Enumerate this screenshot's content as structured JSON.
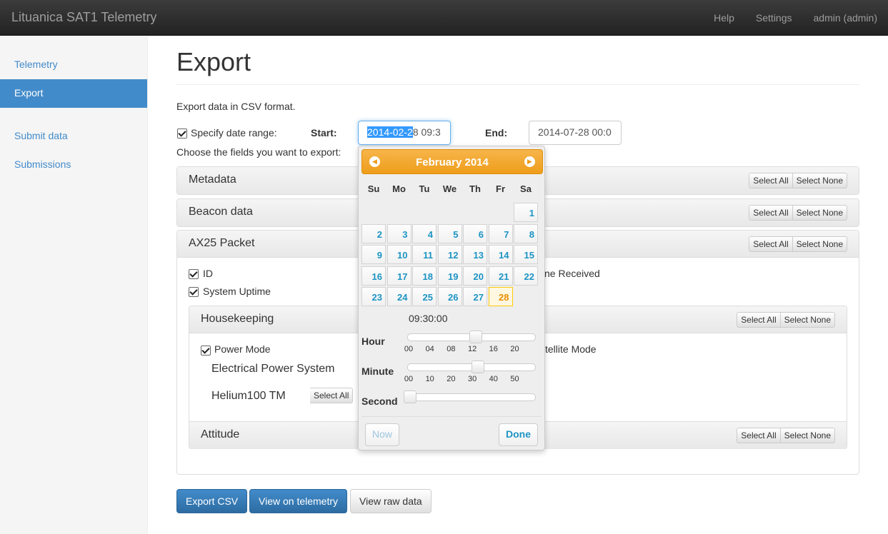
{
  "navbar": {
    "brand": "Lituanica SAT1 Telemetry",
    "links": [
      "Help",
      "Settings",
      "admin (admin)"
    ]
  },
  "sidebar": {
    "items": [
      {
        "label": "Telemetry",
        "active": false
      },
      {
        "label": "Export",
        "active": true
      },
      {
        "label": "Submit data",
        "active": false
      },
      {
        "label": "Submissions",
        "active": false
      }
    ]
  },
  "main": {
    "title": "Export",
    "intro": "Export data in CSV format.",
    "date_range_label": "Specify date range:",
    "date_range_checked": true,
    "start_label": "Start:",
    "start_selected": "2014-02-2",
    "start_rest": "8 09:3",
    "end_label": "End:",
    "end_value": "2014-07-28 00:0",
    "choose_fields": "Choose the fields you want to export:"
  },
  "panels": {
    "select_all": "Select All",
    "select_none": "Select None",
    "metadata": "Metadata",
    "beacon": "Beacon data",
    "ax25": "AX25 Packet",
    "ax25_fields": {
      "id": "ID",
      "uptime": "System Uptime",
      "received_partial": "ne Received"
    },
    "housekeeping": "Housekeeping",
    "hk_fields": {
      "power_mode": "Power Mode",
      "satellite_mode_partial": "tellite Mode"
    },
    "eps": "Electrical Power System",
    "helium": "Helium100 TM",
    "attitude": "Attitude"
  },
  "buttons": {
    "export_csv": "Export CSV",
    "view_telemetry": "View on telemetry",
    "view_raw": "View raw data"
  },
  "datepicker": {
    "month": "February 2014",
    "weekdays": [
      "Su",
      "Mo",
      "Tu",
      "We",
      "Th",
      "Fr",
      "Sa"
    ],
    "first_weekday_index": 6,
    "days_in_month": 28,
    "today": 28,
    "time": "09:30:00",
    "hour_label": "Hour",
    "minute_label": "Minute",
    "second_label": "Second",
    "hour_ticks": [
      "00",
      "04",
      "08",
      "12",
      "16",
      "20"
    ],
    "minute_ticks": [
      "00",
      "10",
      "20",
      "30",
      "40",
      "50"
    ],
    "hour": 9,
    "minute": 30,
    "second": 0,
    "now_label": "Now",
    "done_label": "Done"
  }
}
